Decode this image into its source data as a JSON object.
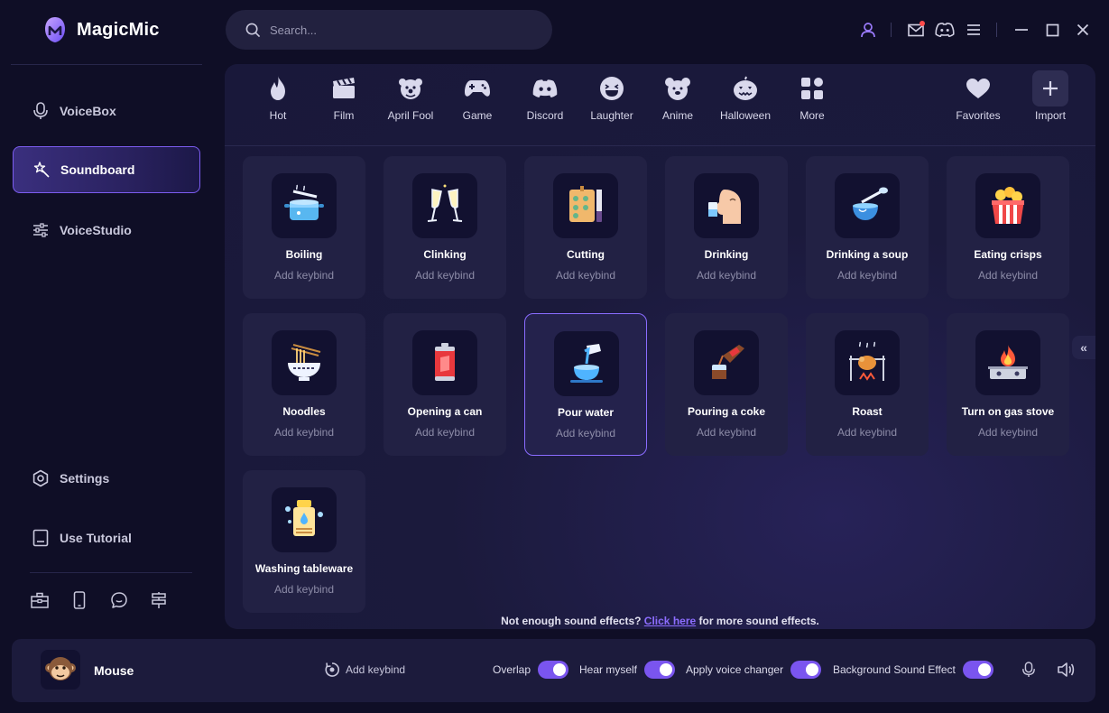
{
  "app": {
    "title": "MagicMic"
  },
  "search": {
    "placeholder": "Search..."
  },
  "sidebar": {
    "items": [
      {
        "label": "VoiceBox",
        "icon": "mic-icon"
      },
      {
        "label": "Soundboard",
        "icon": "magic-wand-icon",
        "active": true
      },
      {
        "label": "VoiceStudio",
        "icon": "sliders-icon"
      }
    ],
    "bottom_items": [
      {
        "label": "Settings",
        "icon": "gear-icon"
      },
      {
        "label": "Use Tutorial",
        "icon": "book-icon"
      }
    ],
    "tools": [
      "toolbox-icon",
      "phone-icon",
      "chat-icon",
      "signpost-icon"
    ]
  },
  "categories": [
    {
      "label": "Hot",
      "icon": "flame-icon"
    },
    {
      "label": "Film",
      "icon": "clapperboard-icon"
    },
    {
      "label": "April Fool",
      "icon": "clown-icon"
    },
    {
      "label": "Game",
      "icon": "gamepad-icon"
    },
    {
      "label": "Discord",
      "icon": "discord-icon"
    },
    {
      "label": "Laughter",
      "icon": "laughing-face-icon"
    },
    {
      "label": "Anime",
      "icon": "bear-icon"
    },
    {
      "label": "Halloween",
      "icon": "pumpkin-icon"
    },
    {
      "label": "More",
      "icon": "grid-icon"
    },
    {
      "label": "Favorites",
      "icon": "heart-icon"
    },
    {
      "label": "Import",
      "icon": "plus-icon"
    }
  ],
  "sounds": [
    {
      "name": "Boiling",
      "keybind": "Add keybind",
      "icon": "boiling-pot-icon"
    },
    {
      "name": "Clinking",
      "keybind": "Add keybind",
      "icon": "champagne-glasses-icon"
    },
    {
      "name": "Cutting",
      "keybind": "Add keybind",
      "icon": "cutting-board-icon"
    },
    {
      "name": "Drinking",
      "keybind": "Add keybind",
      "icon": "drinking-person-icon"
    },
    {
      "name": "Drinking a soup",
      "keybind": "Add keybind",
      "icon": "soup-spoon-icon"
    },
    {
      "name": "Eating crisps",
      "keybind": "Add keybind",
      "icon": "crisps-bucket-icon"
    },
    {
      "name": "Noodles",
      "keybind": "Add keybind",
      "icon": "noodle-bowl-icon"
    },
    {
      "name": "Opening a can",
      "keybind": "Add keybind",
      "icon": "soda-can-icon"
    },
    {
      "name": "Pour water",
      "keybind": "Add keybind",
      "icon": "pouring-water-icon",
      "selected": true
    },
    {
      "name": "Pouring a coke",
      "keybind": "Add keybind",
      "icon": "coke-bottle-icon"
    },
    {
      "name": "Roast",
      "keybind": "Add keybind",
      "icon": "roast-chicken-icon"
    },
    {
      "name": "Turn on gas stove",
      "keybind": "Add keybind",
      "icon": "gas-stove-icon"
    },
    {
      "name": "Washing tableware",
      "keybind": "Add keybind",
      "icon": "washing-dishes-icon"
    }
  ],
  "more_note": {
    "prefix": "Not enough sound effects?",
    "link": "Click here",
    "suffix": "for more sound effects."
  },
  "bottom": {
    "voice_name": "Mouse",
    "add_keybind": "Add keybind",
    "toggles": [
      {
        "label": "Overlap",
        "on": true
      },
      {
        "label": "Hear myself",
        "on": true
      },
      {
        "label": "Apply voice changer",
        "on": true
      },
      {
        "label": "Background Sound Effect",
        "on": true
      }
    ]
  },
  "colors": {
    "accent": "#7a55ef",
    "link": "#8c6dff",
    "background": "#0f0e26",
    "panel": "#1b1a3c"
  }
}
